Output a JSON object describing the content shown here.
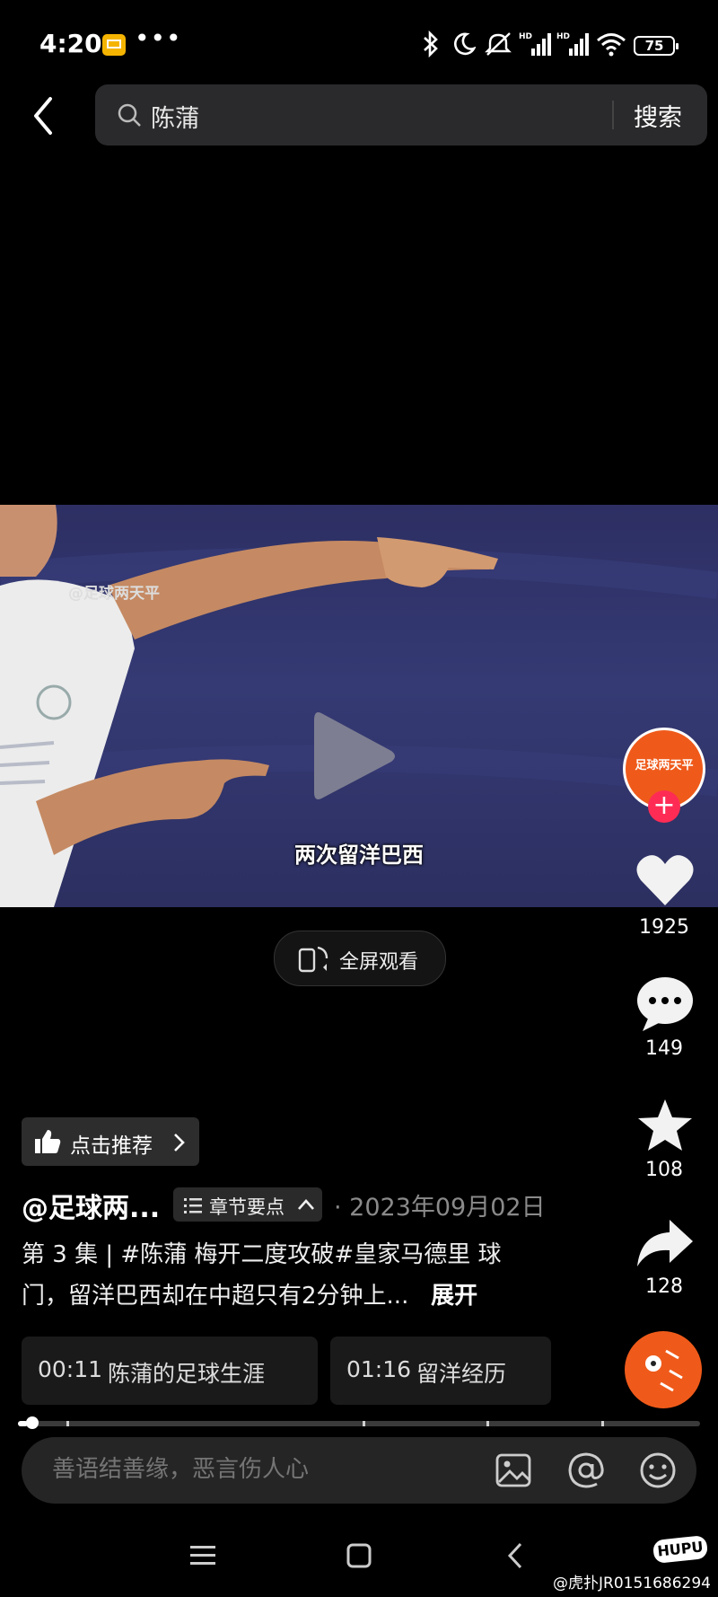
{
  "status_bar": {
    "time": "4:20",
    "more": "•••",
    "battery": "75",
    "icons": [
      "mail-icon",
      "bluetooth-icon",
      "moon-icon",
      "mute-icon",
      "signal-hd-icon",
      "signal-hd-icon",
      "wifi-icon",
      "battery-icon"
    ]
  },
  "search": {
    "query": "陈蒲",
    "button_label": "搜索"
  },
  "video": {
    "watermark": "@足球两天平",
    "subtitle": "两次留洋巴西",
    "fullscreen_label": "全屏观看"
  },
  "rail": {
    "avatar_text": "足球两天平",
    "follow": "+",
    "likes": "1925",
    "comments": "149",
    "favorites": "108",
    "shares": "128"
  },
  "info": {
    "recommend_label": "点击推荐",
    "author": "@足球两...",
    "chapter_label": "章节要点",
    "date": "· 2023年09月02日",
    "caption_line1": "第 3 集 | #陈蒲 梅开二度攻破#皇家马德里 球",
    "caption_line2": "门，留洋巴西却在中超只有2分钟上...",
    "expand": "展开"
  },
  "chapters": [
    {
      "time": "00:11",
      "title": "陈蒲的足球生涯"
    },
    {
      "time": "01:16",
      "title": "留洋经历"
    }
  ],
  "progress": {
    "fraction": 0.015
  },
  "comment": {
    "placeholder": "善语结善缘，恶言伤人心"
  },
  "watermark_corner": {
    "badge": "HUPU",
    "credit": "@虎扑JR0151686294"
  },
  "colors": {
    "accent": "#fe2c55",
    "brand_orange": "#ef5a1a"
  }
}
